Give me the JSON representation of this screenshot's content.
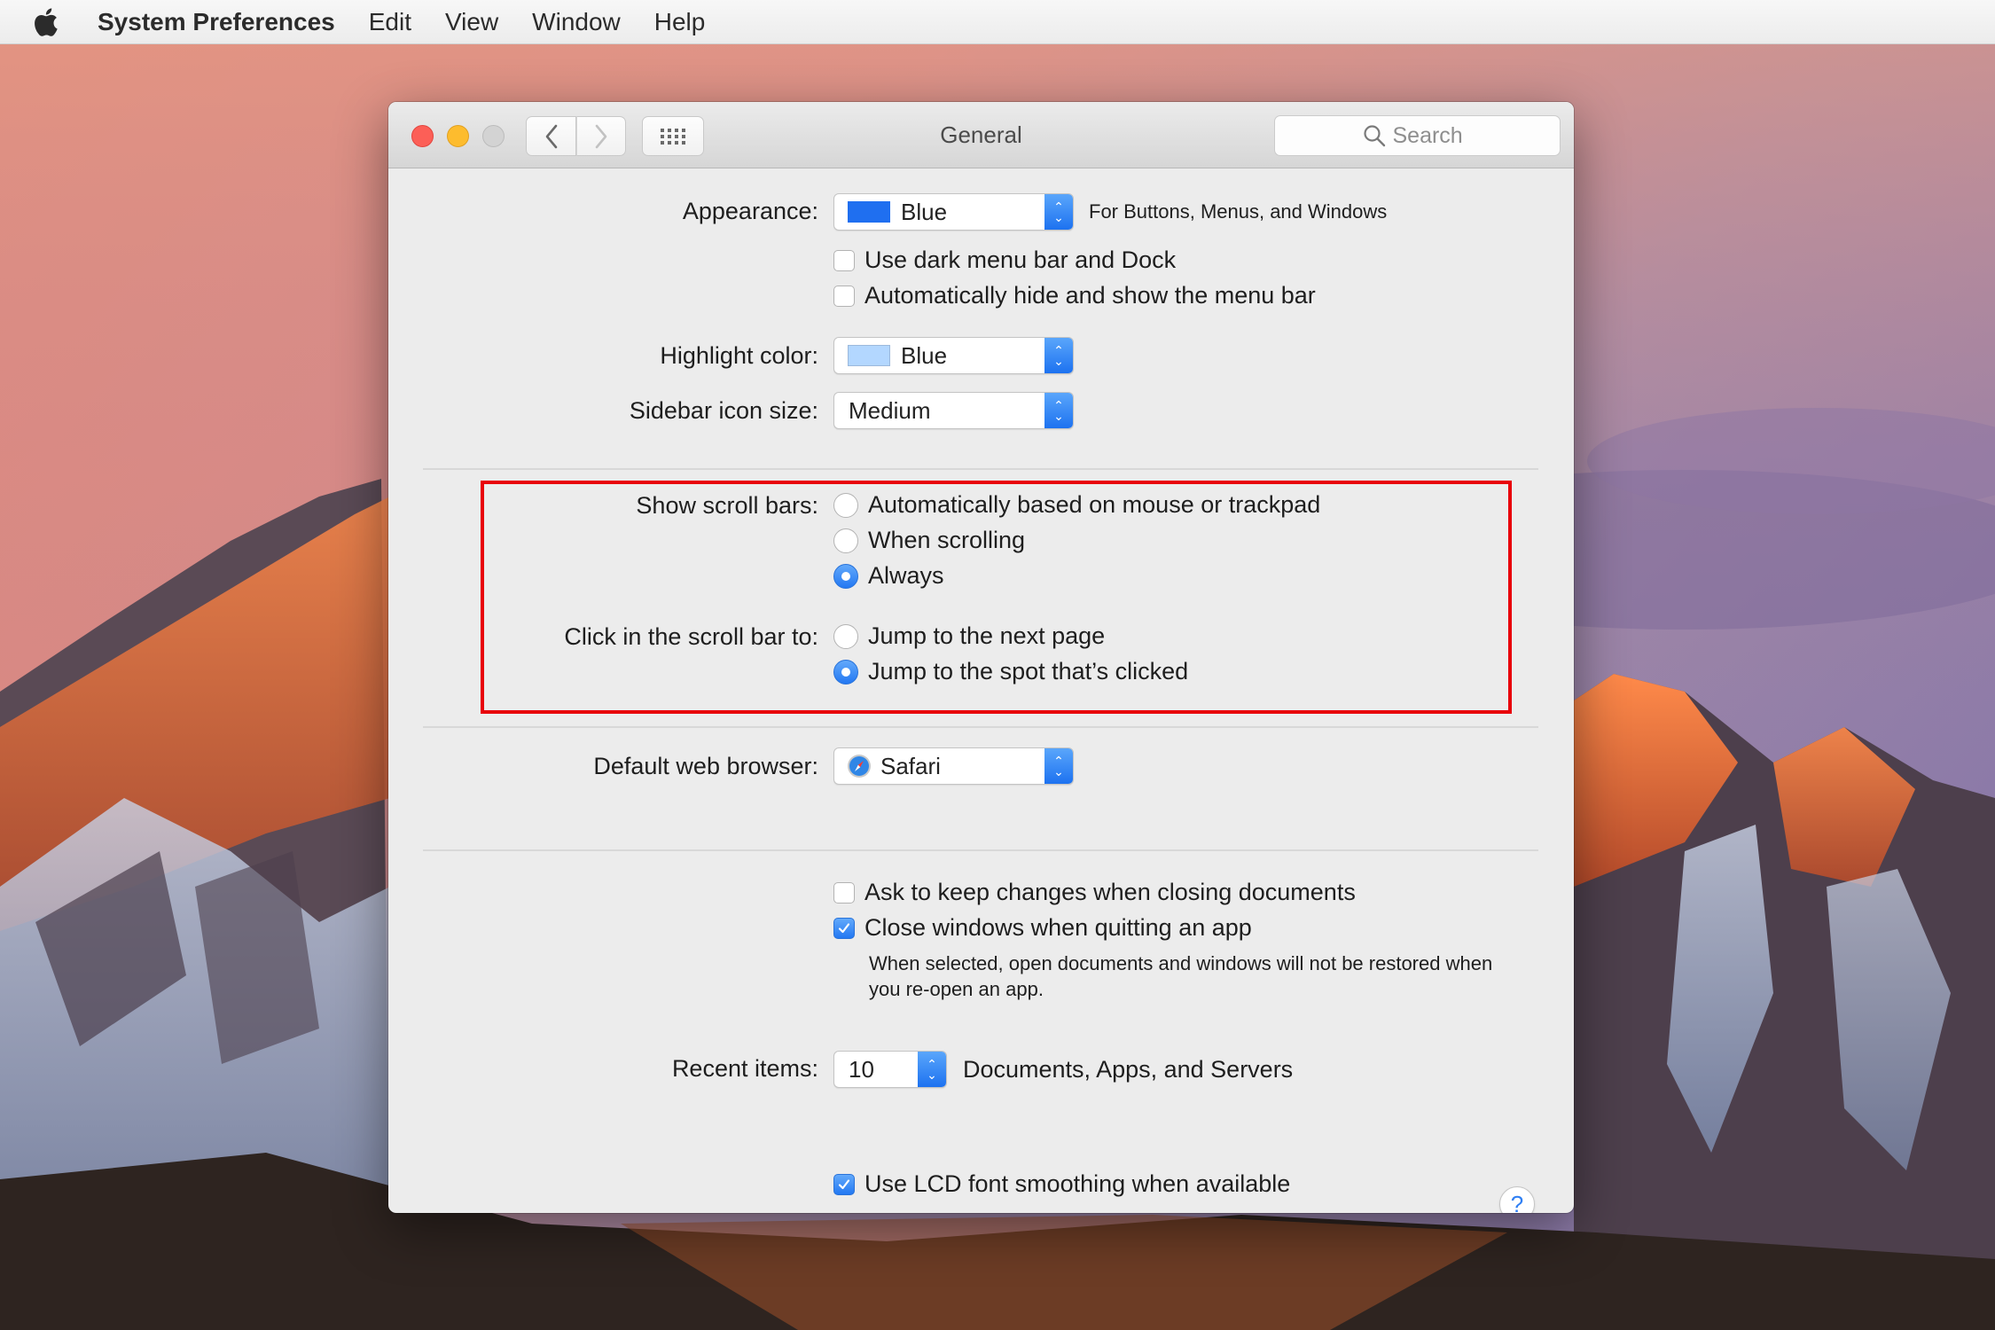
{
  "menubar": {
    "apple_icon": "apple-logo-icon",
    "items": [
      "System Preferences",
      "Edit",
      "View",
      "Window",
      "Help"
    ]
  },
  "window": {
    "title": "General",
    "controls": [
      "close",
      "minimize",
      "zoom"
    ],
    "toolbar": {
      "back_icon": "chevron-left-icon",
      "forward_icon": "chevron-right-icon",
      "grid_icon": "grid-icon"
    },
    "search": {
      "placeholder": "Search",
      "value": ""
    }
  },
  "appearance": {
    "label": "Appearance:",
    "value": "Blue",
    "swatch_color": "#1f6ff0",
    "note": "For Buttons, Menus, and Windows"
  },
  "menu_options": [
    {
      "label": "Use dark menu bar and Dock",
      "checked": false
    },
    {
      "label": "Automatically hide and show the menu bar",
      "checked": false
    }
  ],
  "highlight_color": {
    "label": "Highlight color:",
    "value": "Blue",
    "swatch_color": "#b3d7ff"
  },
  "sidebar_icon_size": {
    "label": "Sidebar icon size:",
    "value": "Medium"
  },
  "scroll_bars": {
    "label": "Show scroll bars:",
    "options": [
      {
        "label": "Automatically based on mouse or trackpad",
        "selected": false
      },
      {
        "label": "When scrolling",
        "selected": false
      },
      {
        "label": "Always",
        "selected": true
      }
    ]
  },
  "scroll_click": {
    "label": "Click in the scroll bar to:",
    "options": [
      {
        "label": "Jump to the next page",
        "selected": false
      },
      {
        "label": "Jump to the spot that’s clicked",
        "selected": true
      }
    ]
  },
  "default_browser": {
    "label": "Default web browser:",
    "value": "Safari",
    "icon": "safari-compass-icon"
  },
  "document_options": [
    {
      "label": "Ask to keep changes when closing documents",
      "checked": false
    },
    {
      "label": "Close windows when quitting an app",
      "checked": true
    }
  ],
  "close_windows_note": "When selected, open documents and windows will not be restored when you re-open an app.",
  "recent_items": {
    "label": "Recent items:",
    "value": "10",
    "note": "Documents, Apps, and Servers"
  },
  "lcd_smoothing": {
    "label": "Use LCD font smoothing when available",
    "checked": true
  },
  "help_button": "?",
  "annotation": {
    "color": "#e8000b",
    "target": "scroll bar settings"
  },
  "colors": {
    "accent": "#2378f2",
    "window_bg": "#ececec",
    "close": "#fc5f57",
    "minimize": "#fdbc2e",
    "zoom": "#d3d3d3"
  }
}
